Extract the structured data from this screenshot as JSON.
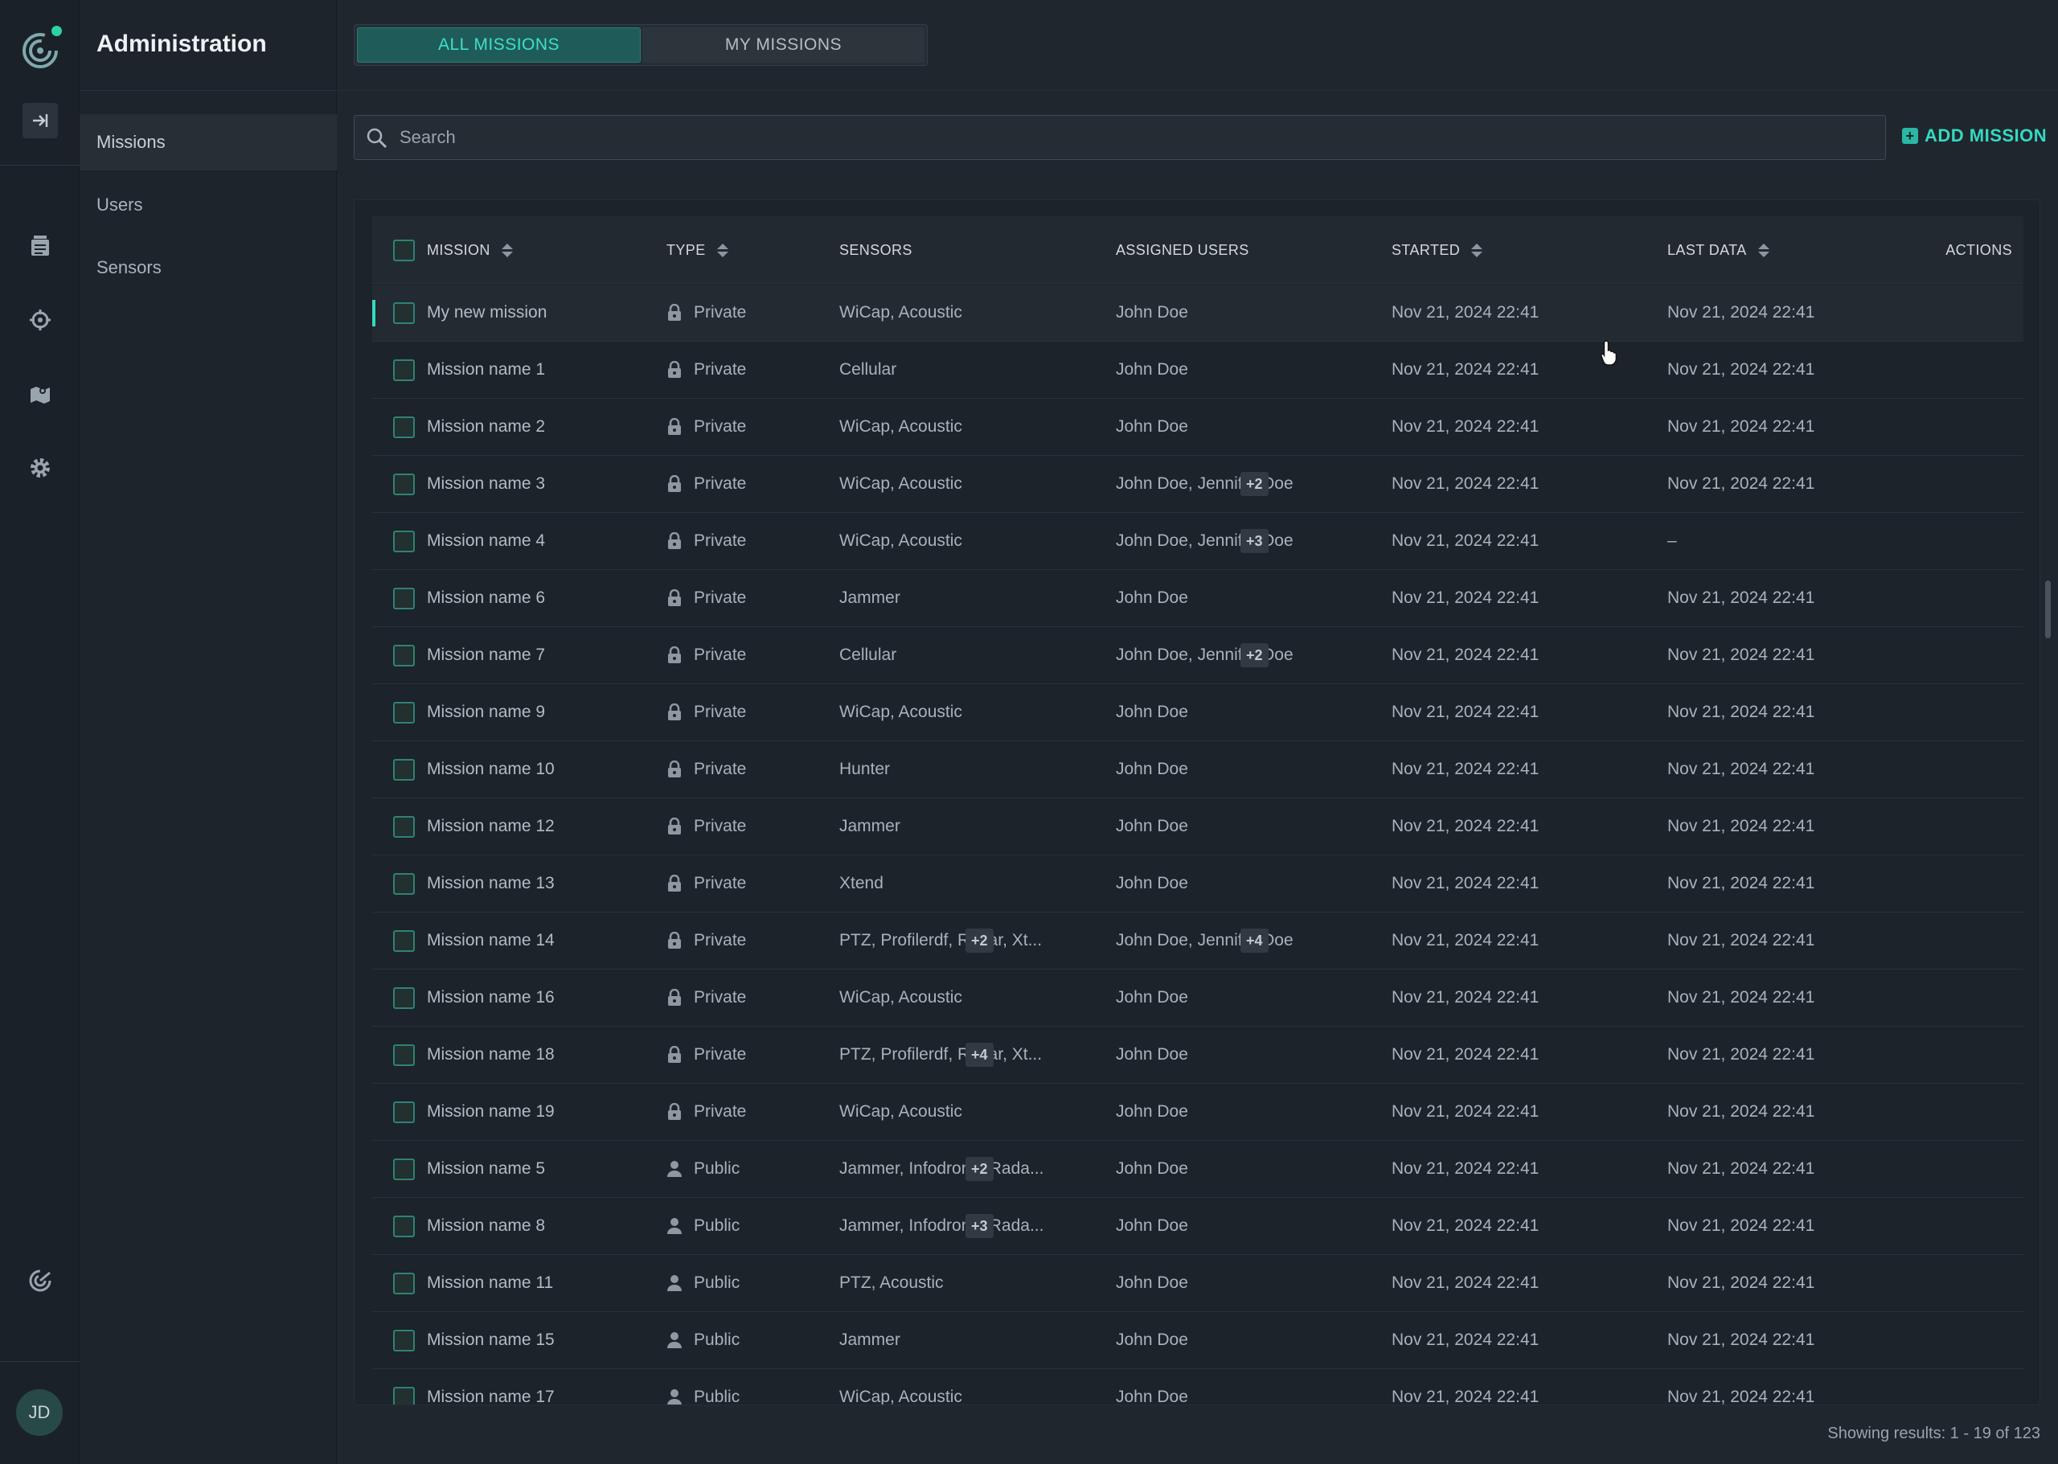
{
  "app": {
    "section_title": "Administration",
    "avatar_initials": "JD",
    "accent_color": "#35d9c0"
  },
  "rail": {
    "icons": [
      "logo-icon",
      "collapse-icon",
      "live-icon",
      "target-icon",
      "map-icon",
      "gear-icon",
      "radar-icon"
    ]
  },
  "subnav": {
    "items": [
      {
        "label": "Missions",
        "active": true
      },
      {
        "label": "Users",
        "active": false
      },
      {
        "label": "Sensors",
        "active": false
      }
    ]
  },
  "tabs": {
    "all_label": "ALL MISSIONS",
    "my_label": "MY MISSIONS",
    "active": "all"
  },
  "search": {
    "placeholder": "Search",
    "value": ""
  },
  "toolbar": {
    "add_label": "ADD MISSION"
  },
  "table": {
    "columns": {
      "mission": "MISSION",
      "type": "TYPE",
      "sensors": "SENSORS",
      "assigned_users": "ASSIGNED USERS",
      "started": "STARTED",
      "last_data": "LAST DATA",
      "actions": "ACTIONS"
    },
    "rows": [
      {
        "mission": "My new mission",
        "type": "Private",
        "sensors": "WiCap, Acoustic",
        "sensors_more": "",
        "users": "John Doe",
        "users_more": "",
        "started": "Nov 21, 2024 22:41",
        "last": "Nov 21, 2024 22:41"
      },
      {
        "mission": "Mission name 1",
        "type": "Private",
        "sensors": "Cellular",
        "sensors_more": "",
        "users": "John Doe",
        "users_more": "",
        "started": "Nov 21, 2024 22:41",
        "last": "Nov 21, 2024 22:41"
      },
      {
        "mission": "Mission name 2",
        "type": "Private",
        "sensors": "WiCap, Acoustic",
        "sensors_more": "",
        "users": "John Doe",
        "users_more": "",
        "started": "Nov 21, 2024 22:41",
        "last": "Nov 21, 2024 22:41"
      },
      {
        "mission": "Mission name 3",
        "type": "Private",
        "sensors": "WiCap, Acoustic",
        "sensors_more": "",
        "users": "John Doe, Jennifer Doe",
        "users_more": "+2",
        "started": "Nov 21, 2024 22:41",
        "last": "Nov 21, 2024 22:41"
      },
      {
        "mission": "Mission name 4",
        "type": "Private",
        "sensors": "WiCap, Acoustic",
        "sensors_more": "",
        "users": "John Doe, Jennifer Doe",
        "users_more": "+3",
        "started": "Nov 21, 2024 22:41",
        "last": "–"
      },
      {
        "mission": "Mission name 6",
        "type": "Private",
        "sensors": "Jammer",
        "sensors_more": "",
        "users": "John Doe",
        "users_more": "",
        "started": "Nov 21, 2024 22:41",
        "last": "Nov 21, 2024 22:41"
      },
      {
        "mission": "Mission name 7",
        "type": "Private",
        "sensors": "Cellular",
        "sensors_more": "",
        "users": "John Doe, Jennifer Doe",
        "users_more": "+2",
        "started": "Nov 21, 2024 22:41",
        "last": "Nov 21, 2024 22:41"
      },
      {
        "mission": "Mission name 9",
        "type": "Private",
        "sensors": "WiCap, Acoustic",
        "sensors_more": "",
        "users": "John Doe",
        "users_more": "",
        "started": "Nov 21, 2024 22:41",
        "last": "Nov 21, 2024 22:41"
      },
      {
        "mission": "Mission name 10",
        "type": "Private",
        "sensors": "Hunter",
        "sensors_more": "",
        "users": "John Doe",
        "users_more": "",
        "started": "Nov 21, 2024 22:41",
        "last": "Nov 21, 2024 22:41"
      },
      {
        "mission": "Mission name 12",
        "type": "Private",
        "sensors": "Jammer",
        "sensors_more": "",
        "users": "John Doe",
        "users_more": "",
        "started": "Nov 21, 2024 22:41",
        "last": "Nov 21, 2024 22:41"
      },
      {
        "mission": "Mission name 13",
        "type": "Private",
        "sensors": "Xtend",
        "sensors_more": "",
        "users": "John Doe",
        "users_more": "",
        "started": "Nov 21, 2024 22:41",
        "last": "Nov 21, 2024 22:41"
      },
      {
        "mission": "Mission name 14",
        "type": "Private",
        "sensors": "PTZ, Profilerdf, Radar, Xt...",
        "sensors_more": "+2",
        "users": "John Doe, Jennifer Doe",
        "users_more": "+4",
        "started": "Nov 21, 2024 22:41",
        "last": "Nov 21, 2024 22:41"
      },
      {
        "mission": "Mission name 16",
        "type": "Private",
        "sensors": "WiCap, Acoustic",
        "sensors_more": "",
        "users": "John Doe",
        "users_more": "",
        "started": "Nov 21, 2024 22:41",
        "last": "Nov 21, 2024 22:41"
      },
      {
        "mission": "Mission name 18",
        "type": "Private",
        "sensors": "PTZ, Profilerdf, Radar, Xt...",
        "sensors_more": "+4",
        "users": "John Doe",
        "users_more": "",
        "started": "Nov 21, 2024 22:41",
        "last": "Nov 21, 2024 22:41"
      },
      {
        "mission": "Mission name 19",
        "type": "Private",
        "sensors": "WiCap, Acoustic",
        "sensors_more": "",
        "users": "John Doe",
        "users_more": "",
        "started": "Nov 21, 2024 22:41",
        "last": "Nov 21, 2024 22:41"
      },
      {
        "mission": "Mission name 5",
        "type": "Public",
        "sensors": "Jammer, Infodrone, Rada...",
        "sensors_more": "+2",
        "users": "John Doe",
        "users_more": "",
        "started": "Nov 21, 2024 22:41",
        "last": "Nov 21, 2024 22:41"
      },
      {
        "mission": "Mission name 8",
        "type": "Public",
        "sensors": "Jammer, Infodrone, Rada...",
        "sensors_more": "+3",
        "users": "John Doe",
        "users_more": "",
        "started": "Nov 21, 2024 22:41",
        "last": "Nov 21, 2024 22:41"
      },
      {
        "mission": "Mission name 11",
        "type": "Public",
        "sensors": "PTZ, Acoustic",
        "sensors_more": "",
        "users": "John Doe",
        "users_more": "",
        "started": "Nov 21, 2024 22:41",
        "last": "Nov 21, 2024 22:41"
      },
      {
        "mission": "Mission name 15",
        "type": "Public",
        "sensors": "Jammer",
        "sensors_more": "",
        "users": "John Doe",
        "users_more": "",
        "started": "Nov 21, 2024 22:41",
        "last": "Nov 21, 2024 22:41"
      },
      {
        "mission": "Mission name 17",
        "type": "Public",
        "sensors": "WiCap, Acoustic",
        "sensors_more": "",
        "users": "John Doe",
        "users_more": "",
        "started": "Nov 21, 2024 22:41",
        "last": "Nov 21, 2024 22:41"
      }
    ]
  },
  "footer": {
    "results_text": "Showing results: 1 - 19 of 123"
  }
}
